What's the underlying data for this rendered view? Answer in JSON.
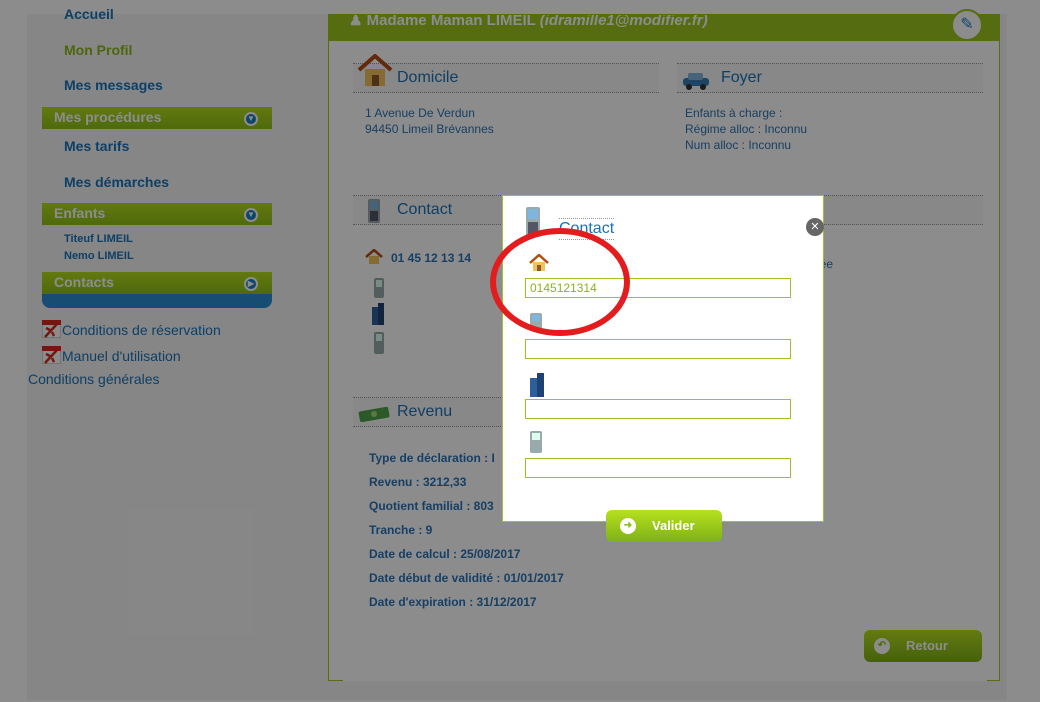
{
  "sidebar": {
    "nav": {
      "accueil": "Accueil",
      "mon_profil": "Mon Profil",
      "mes_messages": "Mes messages"
    },
    "procedures": {
      "label": "Mes procédures",
      "items": [
        "Mes tarifs",
        "Mes démarches"
      ]
    },
    "enfants": {
      "label": "Enfants",
      "items": [
        "Titeuf LIMEIL",
        "Nemo LIMEIL"
      ]
    },
    "contacts": {
      "label": "Contacts"
    },
    "docs": [
      "Conditions de réservation",
      "Manuel d'utilisation",
      "Conditions générales"
    ]
  },
  "panel": {
    "header_name": "Madame Maman LIMEIL",
    "header_email": "(idramille1@modifier.fr)",
    "domicile": {
      "title": "Domicile",
      "lines": [
        "1 Avenue De Verdun",
        "94450 Limeil Brévannes"
      ]
    },
    "foyer": {
      "title": "Foyer",
      "lines": [
        "Enfants à charge :",
        "Régime alloc : Inconnu",
        "Num alloc : Inconnu"
      ]
    },
    "contact": {
      "title": "Contact",
      "phone": "01 45 12 13 14",
      "other_right": "née"
    },
    "revenu": {
      "title": "Revenu",
      "lines": [
        "Type de déclaration : I",
        "Revenu : 3212,33",
        "Quotient familial : 803",
        "Tranche : 9",
        "Date de calcul : 25/08/2017",
        "Date début de validité : 01/01/2017",
        "Date d'expiration : 31/12/2017"
      ]
    },
    "retour_label": "Retour"
  },
  "modal": {
    "title": "Contact",
    "fields": [
      {
        "icon": "home-icon",
        "value": "0145121314"
      },
      {
        "icon": "mobile-icon",
        "value": ""
      },
      {
        "icon": "office-building-icon",
        "value": ""
      },
      {
        "icon": "mobile-phone-icon",
        "value": ""
      }
    ],
    "valider_label": "Valider"
  },
  "colors": {
    "accent_green": "#9cc61e",
    "link_blue": "#1a73b8",
    "highlight_red": "#e31d1d"
  }
}
